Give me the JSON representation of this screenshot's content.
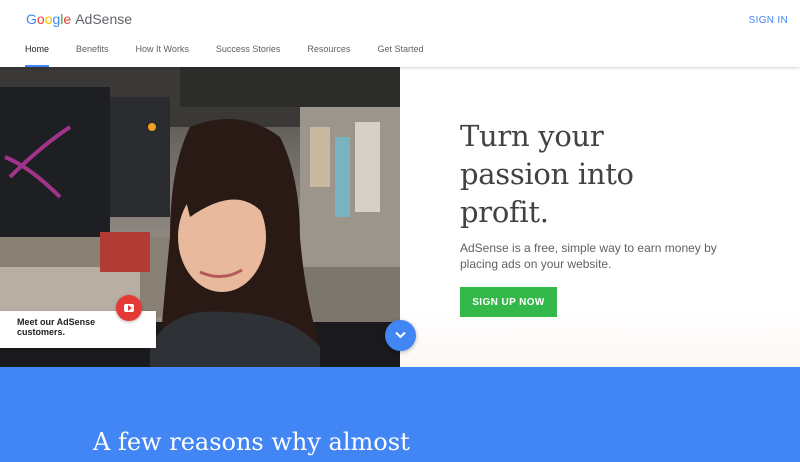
{
  "header": {
    "logo_letters": [
      "G",
      "o",
      "o",
      "g",
      "l",
      "e"
    ],
    "product": "AdSense",
    "signin_label": "SIGN IN"
  },
  "nav": {
    "items": [
      {
        "label": "Home",
        "active": true
      },
      {
        "label": "Benefits",
        "active": false
      },
      {
        "label": "How It Works",
        "active": false
      },
      {
        "label": "Success Stories",
        "active": false
      },
      {
        "label": "Resources",
        "active": false
      },
      {
        "label": "Get Started",
        "active": false
      }
    ]
  },
  "hero": {
    "title": "Turn your passion into profit.",
    "description": "AdSense is a free, simple way to earn money by placing ads on your website.",
    "signup_label": "SIGN UP NOW",
    "video_card_label": "Meet our AdSense customers."
  },
  "reasons": {
    "heading": "A few reasons why almost"
  },
  "colors": {
    "brand_blue": "#4285f4",
    "signup_green": "#34b84a",
    "youtube_red": "#e53935"
  },
  "icons": [
    "youtube-play-icon",
    "chevron-down-icon"
  ]
}
